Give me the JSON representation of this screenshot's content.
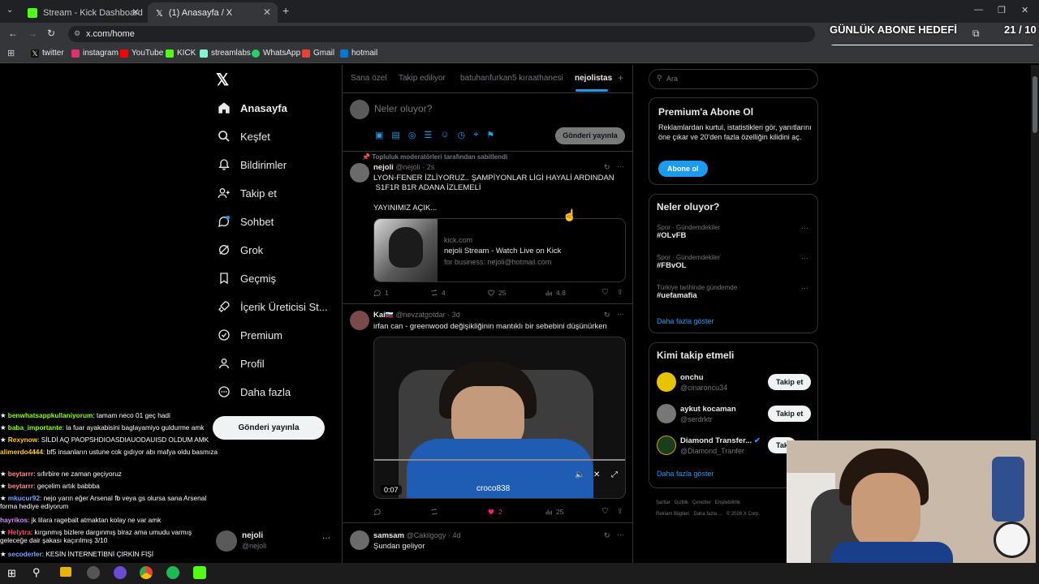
{
  "browser": {
    "tabs": [
      {
        "label": "Stream - Kick Dashboard",
        "color": "#53fc18"
      },
      {
        "label": "(1) Anasayfa / X",
        "color": "#ffffff"
      }
    ],
    "url": "x.com/home",
    "bookmarks": [
      {
        "label": "twitter",
        "color": "#1d9bf0"
      },
      {
        "label": "instagram",
        "color": "#e1306c"
      },
      {
        "label": "YouTube",
        "color": "#ff0000"
      },
      {
        "label": "KICK",
        "color": "#53fc18"
      },
      {
        "label": "streamlabs",
        "color": "#80f5d2"
      },
      {
        "label": "WhatsApp",
        "color": "#25d366"
      },
      {
        "label": "Gmail",
        "color": "#ea4335"
      },
      {
        "label": "hotmail",
        "color": "#0078d4"
      }
    ]
  },
  "overlay": {
    "goal_title": "GÜNLÜK ABONE HEDEFİ",
    "goal_count": "21 / 10"
  },
  "nav": {
    "items": [
      {
        "label": "Anasayfa",
        "icon": "home-icon"
      },
      {
        "label": "Keşfet",
        "icon": "search-icon"
      },
      {
        "label": "Bildirimler",
        "icon": "bell-icon"
      },
      {
        "label": "Takip et",
        "icon": "follow-icon"
      },
      {
        "label": "Sohbet",
        "icon": "chat-icon"
      },
      {
        "label": "Grok",
        "icon": "grok-icon"
      },
      {
        "label": "Geçmiş",
        "icon": "bookmark-icon"
      },
      {
        "label": "İçerik Üreticisi St...",
        "icon": "rocket-icon"
      },
      {
        "label": "Premium",
        "icon": "verified-icon"
      },
      {
        "label": "Profil",
        "icon": "user-icon"
      },
      {
        "label": "Daha fazla",
        "icon": "more-icon"
      }
    ],
    "post_button": "Gönderi yayınla",
    "account": {
      "name": "nejoli",
      "handle": "@nejoli"
    }
  },
  "center": {
    "tabs": [
      "Sana özel",
      "Takip ediliyor",
      "batuhanfurkan5 kıraathanesi",
      "nejolistas"
    ],
    "composer": {
      "placeholder": "Neler oluyor?",
      "submit": "Gönderi yayınla"
    },
    "pinned_label": "Topluluk moderatörleri tarafından sabitlendi",
    "post1": {
      "name": "nejoli",
      "handle": "@nejoli",
      "time": "2s",
      "text1": "LYON-FENER İZLİYORUZ.. ŞAMPİYONLAR LİGİ HAYALİ ARDINDAN",
      "text2": " S1F1R B1R ADANA İZLEMELİ",
      "text3": "YAYINIMIZ AÇIK...",
      "card": {
        "domain": "kick.com",
        "title": "nejoli Stream - Watch Live on Kick",
        "desc": "for business: nejoli@hotmail.com"
      },
      "stats": {
        "replies": "1",
        "reposts": "4",
        "likes": "25",
        "views": "4.8"
      }
    },
    "post2": {
      "name": "Kai",
      "handle": "@nevzatgotdar",
      "time": "3d",
      "text": "irfan can - greenwood değişikliğinin mantıklı bir sebebini düşünürken",
      "video": {
        "time": "0:07",
        "watermark": "croco838"
      },
      "stats": {
        "likes": "2",
        "views": "25"
      }
    },
    "post3": {
      "name": "samsam",
      "handle": "@Cakilgogy",
      "time": "4d",
      "text": "Şundan geliyor"
    }
  },
  "right": {
    "search_placeholder": "Ara",
    "premium": {
      "title": "Premium'a Abone Ol",
      "body": "Reklamlardan kurtul, istatistikleri gör, yanıtlarını öne çıkar ve 20'den fazla özelliğin kilidini aç.",
      "button": "Abone ol"
    },
    "trends": {
      "title": "Neler oluyor?",
      "items": [
        {
          "category": "Spor · Gündemdekiler",
          "name": "#OLvFB"
        },
        {
          "category": "Spor · Gündemdekiler",
          "name": "#FBvOL"
        },
        {
          "category": "Türkiye tarihinde gündemde",
          "name": "#uefamafia"
        }
      ],
      "more": "Daha fazla göster"
    },
    "who_to_follow": {
      "title": "Kimi takip etmeli",
      "items": [
        {
          "name": "onchu",
          "handle": "@cinaroncu34",
          "button": "Takip et"
        },
        {
          "name": "aykut kocaman",
          "handle": "@serdrktr",
          "button": "Takip et"
        },
        {
          "name": "Diamond Transfer...",
          "handle": "@Diamond_Tranfer",
          "button": "Tak"
        }
      ],
      "more": "Daha fazla göster"
    },
    "footer": [
      "Şartlar",
      "Gizlilik",
      "Çerezler",
      "Erişilebilirlik",
      "Reklam Bilgileri",
      "Daha fazla ...",
      "© 2026 X Corp."
    ]
  },
  "chat": [
    {
      "user": "benwhatsappkullaniyorum",
      "color": "#8cff00",
      "msg": ": tamam neco 01 geç hadi"
    },
    {
      "user": "baba_importante",
      "color": "#8cff00",
      "msg": ": la fuar ayakabisini baglayamiyo guldurme amk"
    },
    {
      "user": "Rexynow",
      "color": "#ffcc00",
      "msg": ": SİLDİ AQ PAOPSHDIOASDIAUODAUISD OLDUM AMK"
    },
    {
      "user": "alimerdo4444",
      "color": "#ffcc00",
      "msg": ": bf5 insanların ustune cok gıdıyor abı mafya oldu basmıza"
    },
    {
      "user": "beytarrr",
      "color": "#ff8a8a",
      "msg": ": sıfırbire ne zaman geçiyoruz"
    },
    {
      "user": "beytarrr",
      "color": "#ff8a8a",
      "msg": ": geçelim artık babbba"
    },
    {
      "user": "mkucur92",
      "color": "#6ea8ff",
      "msg": ": nejo yarın eğer Arsenal fb veya gs olursa sana Arsenal forma hediye ediyorum"
    },
    {
      "user": "hayrikos",
      "color": "#d28cff",
      "msg": ": jk lilara ragebait atmaktan kolay ne var amk"
    },
    {
      "user": "Helytra",
      "color": "#ff4d6d",
      "msg": ": kırgınmış bizlere dargınmış biraz ama umudu varmış geleceğe dair şakası kaçırılmış 3/10"
    },
    {
      "user": "secoderler",
      "color": "#6ea8ff",
      "msg": ": KESİN İNTERNETİBNİ ÇIRKİN FİŞİ"
    }
  ],
  "colors": {
    "x_blue": "#1d9bf0",
    "x_border": "#2f3336",
    "x_muted": "#71767b",
    "like_pink": "#f91880"
  }
}
